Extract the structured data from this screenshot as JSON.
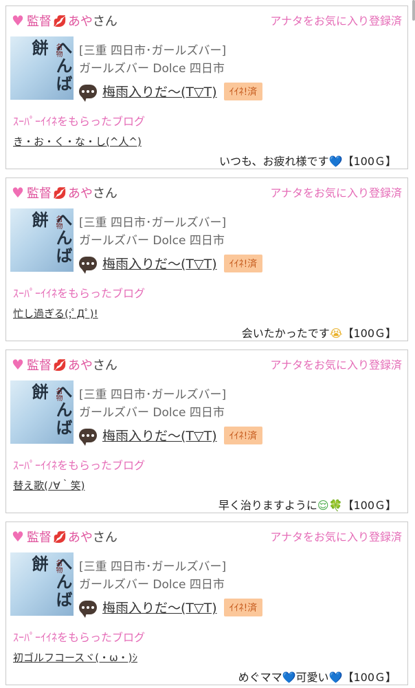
{
  "cards": [
    {
      "user_title": "監督",
      "user_name": "あや",
      "user_suffix": "さん",
      "fav_link": "アナタをお気に入り登録済",
      "area": "[三重 四日市･ガールズバー]",
      "shop": "ガールズバー Dolce 四日市",
      "blog_title": "梅雨入りだ〜(T▽T)",
      "iine_badge": "ｲｲﾈ!済",
      "super_label": "ｽｰﾊﾟｰｲｲﾈをもらったブログ",
      "super_blog": "き・お・く・な・し(^人^)",
      "message": "いつも、お疲れ様です",
      "message_emoji": "💙",
      "amount": "【100Ｇ】"
    },
    {
      "user_title": "監督",
      "user_name": "あや",
      "user_suffix": "さん",
      "fav_link": "アナタをお気に入り登録済",
      "area": "[三重 四日市･ガールズバー]",
      "shop": "ガールズバー Dolce 四日市",
      "blog_title": "梅雨入りだ〜(T▽T)",
      "iine_badge": "ｲｲﾈ!済",
      "super_label": "ｽｰﾊﾟｰｲｲﾈをもらったブログ",
      "super_blog": "忙し過ぎる(;ﾟДﾟ)!",
      "message": "会いたかったです",
      "message_emoji": "😭",
      "amount": "【100Ｇ】"
    },
    {
      "user_title": "監督",
      "user_name": "あや",
      "user_suffix": "さん",
      "fav_link": "アナタをお気に入り登録済",
      "area": "[三重 四日市･ガールズバー]",
      "shop": "ガールズバー Dolce 四日市",
      "blog_title": "梅雨入りだ〜(T▽T)",
      "iine_badge": "ｲｲﾈ!済",
      "super_label": "ｽｰﾊﾟｰｲｲﾈをもらったブログ",
      "super_blog": "替え歌(ﾉ∀｀笑)",
      "message": "早く治りますように",
      "message_emoji": "😌🍀",
      "amount": "【100Ｇ】"
    },
    {
      "user_title": "監督",
      "user_name": "あや",
      "user_suffix": "さん",
      "fav_link": "アナタをお気に入り登録済",
      "area": "[三重 四日市･ガールズバー]",
      "shop": "ガールズバー Dolce 四日市",
      "blog_title": "梅雨入りだ〜(T▽T)",
      "iine_badge": "ｲｲﾈ!済",
      "super_label": "ｽｰﾊﾟｰｲｲﾈをもらったブログ",
      "super_blog": "初ゴルフコースヾ(・ω・)ｼ",
      "message": "めぐママ💙可愛い",
      "message_emoji": "💙",
      "amount": "【100Ｇ】"
    }
  ],
  "thumbnail": {
    "text_main": "へんば餅",
    "text_small": "名物"
  },
  "colors": {
    "accent_pink": "#e56cb7",
    "badge_bg": "#fbc79a",
    "border": "#c9c9c9"
  }
}
